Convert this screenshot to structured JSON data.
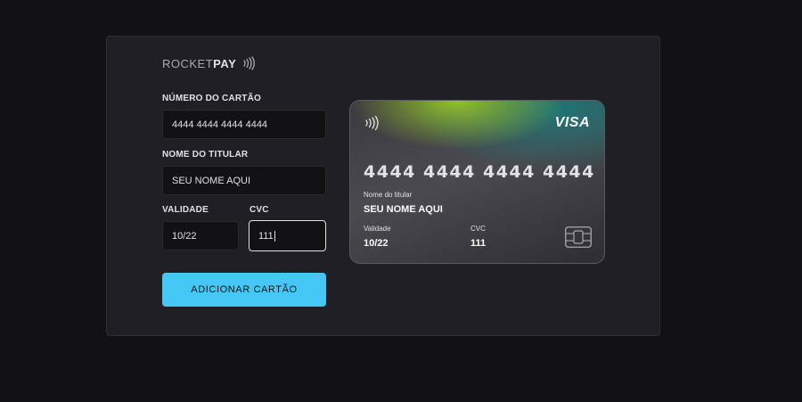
{
  "brand": {
    "word1": "ROCKET",
    "word2": "PAY"
  },
  "form": {
    "number_label": "NÚMERO DO CARTÃO",
    "number_value": "4444 4444 4444 4444",
    "name_label": "NOME DO TITULAR",
    "name_value": "SEU NOME AQUI",
    "expiry_label": "VALIDADE",
    "expiry_value": "10/22",
    "cvc_label": "CVC",
    "cvc_value": "111",
    "submit_label": "ADICIONAR CARTÃO"
  },
  "card": {
    "brand": "VISA",
    "number": "4444 4444 4444 4444",
    "holder_label": "Nome do titular",
    "holder_value": "SEU NOME AQUI",
    "expiry_label": "Validade",
    "expiry_value": "10/22",
    "cvc_label": "CVC",
    "cvc_value": "111"
  },
  "colors": {
    "background": "#121214",
    "panel": "#202024",
    "input": "#121214",
    "accent": "#44c7f5"
  },
  "icons": {
    "contactless": "contactless-icon",
    "chip": "card-chip-icon"
  }
}
